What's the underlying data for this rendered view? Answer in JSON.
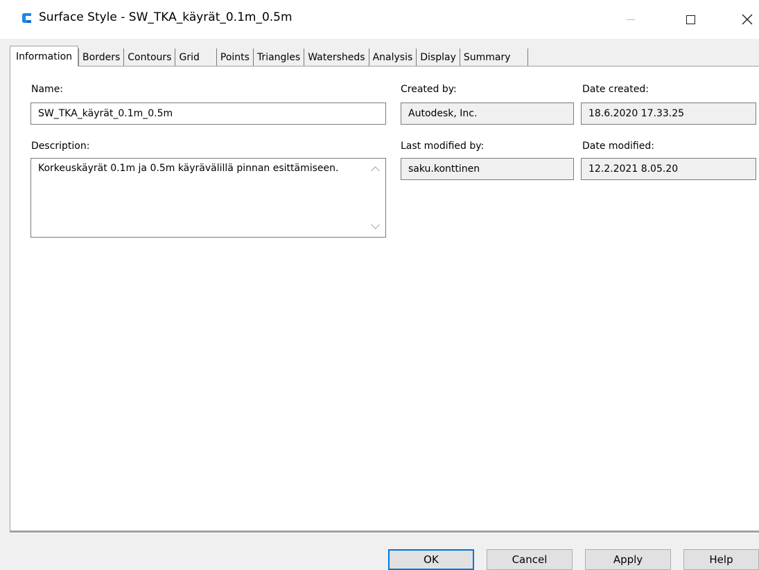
{
  "window": {
    "title": "Surface Style - SW_TKA_käyrät_0.1m_0.5m",
    "app_icon": "civil3d-c-icon",
    "accent_color": "#0078d7",
    "icon_color": "#1e88e5"
  },
  "tabs": [
    {
      "label": "Information",
      "active": true
    },
    {
      "label": "Borders"
    },
    {
      "label": "Contours"
    },
    {
      "label": "Grid"
    },
    {
      "label": "Points"
    },
    {
      "label": "Triangles"
    },
    {
      "label": "Watersheds"
    },
    {
      "label": "Analysis"
    },
    {
      "label": "Display"
    },
    {
      "label": "Summary"
    }
  ],
  "info": {
    "name_label": "Name:",
    "name_value": "SW_TKA_käyrät_0.1m_0.5m",
    "description_label": "Description:",
    "description_value": "Korkeuskäyrät 0.1m ja 0.5m käyrävälillä pinnan esittämiseen.",
    "created_by_label": "Created by:",
    "created_by_value": "Autodesk, Inc.",
    "date_created_label": "Date created:",
    "date_created_value": "18.6.2020 17.33.25",
    "last_modified_by_label": "Last modified by:",
    "last_modified_by_value": "saku.konttinen",
    "date_modified_label": "Date modified:",
    "date_modified_value": "12.2.2021 8.05.20"
  },
  "buttons": {
    "ok": "OK",
    "cancel": "Cancel",
    "apply": "Apply",
    "help": "Help"
  }
}
